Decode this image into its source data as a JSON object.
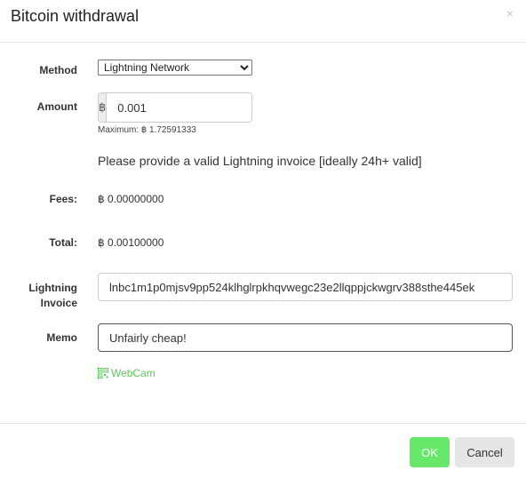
{
  "header": {
    "title": "Bitcoin withdrawal",
    "close_label": "×"
  },
  "form": {
    "method_label": "Method",
    "method_selected": "Lightning Network",
    "amount_label": "Amount",
    "currency_symbol": "฿",
    "amount_value": "0.001",
    "maximum_text": "Maximum: ฿ 1.72591333",
    "notice": "Please provide a valid Lightning invoice [ideally 24h+ valid]",
    "fees_label": "Fees:",
    "fees_value": "฿ 0.00000000",
    "total_label": "Total:",
    "total_value": "฿ 0.00100000",
    "invoice_label_line1": "Lightning",
    "invoice_label_line2": "Invoice",
    "invoice_value": "lnbc1m1p0mjsv9pp524klhglrpkhqvwegc23e2llqppjckwgrv388sthe445ek",
    "memo_label": "Memo",
    "memo_value": "Unfairly cheap!",
    "webcam_label": "WebCam"
  },
  "footer": {
    "ok_label": "OK",
    "cancel_label": "Cancel"
  },
  "colors": {
    "ok_button": "#68e868",
    "webcam_link": "#5bc85b",
    "cancel_button": "#e6e6e6"
  },
  "icons": {
    "close": "close-icon",
    "webcam": "qr-code-icon"
  }
}
